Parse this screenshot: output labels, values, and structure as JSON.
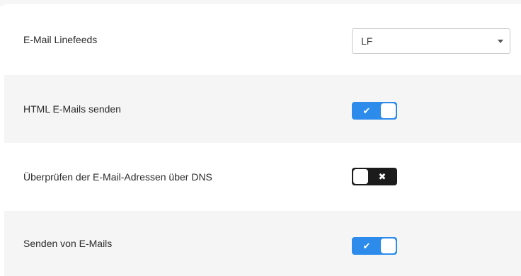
{
  "settings": [
    {
      "label": "E-Mail Linefeeds",
      "type": "select",
      "value": "LF"
    },
    {
      "label": "HTML E-Mails senden",
      "type": "toggle",
      "checked": true,
      "icon": "check-icon"
    },
    {
      "label": "Überprüfen der E-Mail-Adressen über DNS",
      "type": "toggle",
      "checked": false,
      "icon": "x-icon"
    },
    {
      "label": "Senden von E-Mails",
      "type": "toggle",
      "checked": true,
      "icon": "check-icon"
    }
  ],
  "glyphs": {
    "check": "✔",
    "cross": "✖"
  },
  "colors": {
    "toggle_on": "#2d8ceb",
    "toggle_off": "#1b1b1b",
    "row_alt": "#f5f5f5"
  }
}
